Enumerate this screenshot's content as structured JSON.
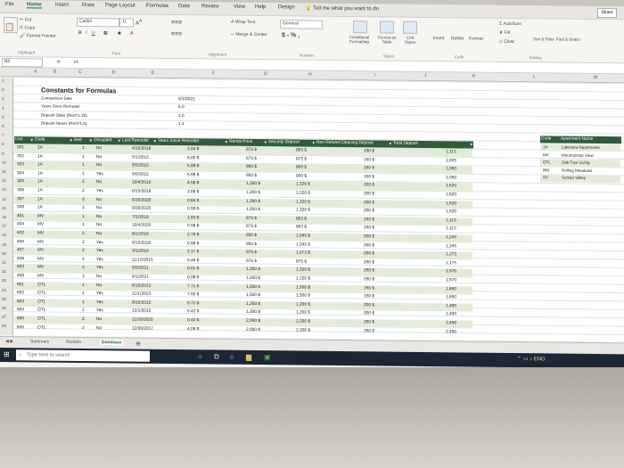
{
  "ribbon_tabs": [
    "File",
    "Home",
    "Insert",
    "Draw",
    "Page Layout",
    "Formulas",
    "Data",
    "Review",
    "View",
    "Help",
    "Design"
  ],
  "tell_me": "Tell me what you want to do",
  "share": "Share",
  "ribbon": {
    "cut": "Cut",
    "copy": "Copy",
    "format_painter": "Format Painter",
    "font_name": "Calibri",
    "font_size": "11",
    "wrap_text": "Wrap Text",
    "merge_center": "Merge & Center",
    "number_format": "General",
    "currency": "$ - % ,",
    "conditional": "Conditional Formatting",
    "format_as_table": "Format as Table",
    "cell_styles": "Cell Styles",
    "insert": "Insert",
    "delete": "Delete",
    "format": "Format",
    "autosum": "AutoSum",
    "fill": "Fill",
    "clear": "Clear",
    "sort_filter": "Sort & Filter",
    "find_select": "Find & Select",
    "groups": [
      "Clipboard",
      "Font",
      "Alignment",
      "Number",
      "Styles",
      "Cells",
      "Editing"
    ]
  },
  "formula_bar": {
    "name_box": "B8",
    "fx": "fx",
    "value": "1A"
  },
  "columns": [
    "A",
    "B",
    "C",
    "D",
    "E",
    "F",
    "G",
    "H",
    "I",
    "J",
    "K",
    "L",
    "M"
  ],
  "row_numbers": [
    "1",
    "2",
    "3",
    "4",
    "5",
    "6",
    "7",
    "8",
    "9",
    "10",
    "11",
    "12",
    "13",
    "14",
    "15",
    "16",
    "17",
    "18",
    "19",
    "20",
    "21",
    "22",
    "23",
    "24",
    "25",
    "26",
    "27",
    "28"
  ],
  "constants": {
    "title": "Constants for Formulas",
    "rows": [
      {
        "label": "Comparison Date",
        "value": "5/1/2021"
      },
      {
        "label": "Years Since Remodel",
        "value": "5.0"
      },
      {
        "label": "Deposit Older (Rent*1.25)",
        "value": "1.0"
      },
      {
        "label": "Deposit Newer (Rent*1.5)",
        "value": "1.1"
      }
    ]
  },
  "table": {
    "headers": [
      "Unit",
      "Code",
      "Bed",
      "Occupied",
      "Last Remodel",
      "Years Since Remodel",
      "Rental Price",
      "Security Deposit",
      "Non-Refund Cleaning Deposit",
      "Total Deposit"
    ],
    "rows": [
      [
        "301",
        "1A",
        "1",
        "No",
        "4/15/2018",
        "3.04 $",
        "875 $",
        "963 $",
        "150 $",
        "1,113"
      ],
      [
        "302",
        "1A",
        "1",
        "No",
        "5/1/2015",
        "6.00 $",
        "875 $",
        "875 $",
        "150 $",
        "1,025"
      ],
      [
        "303",
        "1A",
        "1",
        "No",
        "5/5/2015",
        "5.99 $",
        "900 $",
        "900 $",
        "150 $",
        "1,050"
      ],
      [
        "304",
        "1A",
        "1",
        "Yes",
        "5/5/2015",
        "5.99 $",
        "900 $",
        "900 $",
        "150 $",
        "1,050"
      ],
      [
        "305",
        "1A",
        "2",
        "No",
        "10/4/2016",
        "4.58 $",
        "1,200 $",
        "1,320 $",
        "200 $",
        "1,520"
      ],
      [
        "306",
        "1A",
        "2",
        "Yes",
        "6/15/2018",
        "2.88 $",
        "1,200 $",
        "1,320 $",
        "200 $",
        "1,520"
      ],
      [
        "307",
        "1A",
        "2",
        "No",
        "6/30/2020",
        "0.84 $",
        "1,200 $",
        "1,320 $",
        "200 $",
        "1,520"
      ],
      [
        "308",
        "1A",
        "2",
        "No",
        "9/30/2020",
        "0.59 $",
        "1,200 $",
        "1,320 $",
        "200 $",
        "1,520"
      ],
      [
        "401",
        "MV",
        "1",
        "No",
        "7/1/2019",
        "1.83 $",
        "875 $",
        "963 $",
        "150 $",
        "1,113"
      ],
      [
        "404",
        "MV",
        "1",
        "No",
        "10/4/2020",
        "0.58 $",
        "875 $",
        "963 $",
        "150 $",
        "1,113"
      ],
      [
        "402",
        "MV",
        "2",
        "No",
        "8/1/2018",
        "2.75 $",
        "950 $",
        "1,045 $",
        "200 $",
        "1,245"
      ],
      [
        "405",
        "MV",
        "2",
        "Yes",
        "6/15/2020",
        "0.88 $",
        "950 $",
        "1,045 $",
        "200 $",
        "1,245"
      ],
      [
        "407",
        "MV",
        "2",
        "Yes",
        "3/1/2019",
        "2.17 $",
        "975 $",
        "1,073 $",
        "200 $",
        "1,273"
      ],
      [
        "408",
        "MV",
        "2",
        "Yes",
        "11/15/2015",
        "5.46 $",
        "975 $",
        "975 $",
        "200 $",
        "1,175"
      ],
      [
        "403",
        "MV",
        "3",
        "Yes",
        "5/5/2021",
        "0.01 $",
        "1,200 $",
        "1,320 $",
        "250 $",
        "1,570"
      ],
      [
        "406",
        "MV",
        "3",
        "No",
        "4/1/2021",
        "0.08 $",
        "1,200 $",
        "1,320 $",
        "250 $",
        "1,570"
      ],
      [
        "601",
        "OTL",
        "1",
        "No",
        "8/15/2013",
        "7.71 $",
        "1,500 $",
        "1,500 $",
        "150 $",
        "1,650"
      ],
      [
        "602",
        "OTL",
        "1",
        "Yes",
        "11/1/2013",
        "7.50 $",
        "1,500 $",
        "1,500 $",
        "150 $",
        "1,650"
      ],
      [
        "603",
        "OTL",
        "1",
        "Yes",
        "8/15/2015",
        "5.71 $",
        "1,200 $",
        "1,200 $",
        "200 $",
        "1,400"
      ],
      [
        "604",
        "OTL",
        "2",
        "Yes",
        "12/1/2015",
        "5.42 $",
        "1,200 $",
        "1,200 $",
        "200 $",
        "1,400"
      ],
      [
        "605",
        "OTL",
        "2",
        "No",
        "11/30/2020",
        "0.42 $",
        "2,000 $",
        "2,200 $",
        "250 $",
        "2,450"
      ],
      [
        "606",
        "OTL",
        "2",
        "No",
        "12/30/2017",
        "4.09 $",
        "2,000 $",
        "2,200 $",
        "250 $",
        "2,450"
      ]
    ]
  },
  "lookup": {
    "headers": [
      "Code",
      "Apartment Name"
    ],
    "rows": [
      [
        "1A",
        "Lakeview Apartments"
      ],
      [
        "MV",
        "Mountaintop View"
      ],
      [
        "OTL",
        "Oak Tree Living"
      ],
      [
        "RM",
        "Rolling Meadows"
      ],
      [
        "SV",
        "Sunset Valley"
      ]
    ]
  },
  "sheet_tabs": [
    "Summary",
    "Rentals",
    "Database"
  ],
  "taskbar": {
    "search_placeholder": "Type here to search"
  },
  "colors": {
    "excel_green": "#1e6b3c",
    "table_header": "#2f5d3a",
    "band": "#e3ecd8"
  }
}
